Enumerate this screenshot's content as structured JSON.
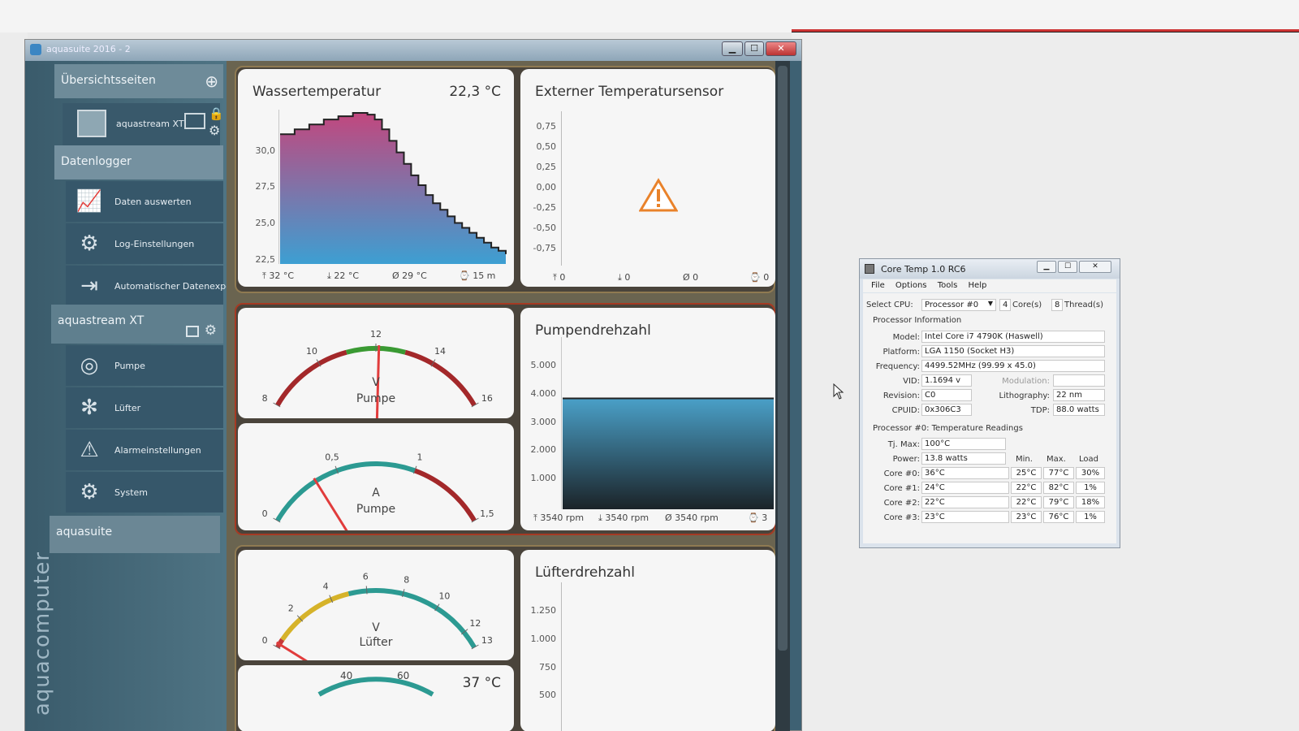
{
  "aquasuite": {
    "title": "aquasuite 2016 - 2",
    "sidebar": {
      "sections": [
        {
          "label": "Übersichtsseiten"
        },
        {
          "label": "Datenlogger"
        },
        {
          "label": "aquastream XT"
        },
        {
          "label": "aquasuite"
        }
      ],
      "overview_item": "aquastream XT",
      "datalogger_items": [
        {
          "label": "Daten auswerten",
          "icon": "chart-icon"
        },
        {
          "label": "Log-Einstellungen",
          "icon": "gear-icon"
        },
        {
          "label": "Automatischer Datenexport",
          "icon": "export-icon"
        }
      ],
      "device_items": [
        {
          "label": "Pumpe",
          "icon": "pump-icon"
        },
        {
          "label": "Lüfter",
          "icon": "fan-icon"
        },
        {
          "label": "Alarmeinstellungen",
          "icon": "warning-icon"
        },
        {
          "label": "System",
          "icon": "gear-icon"
        }
      ],
      "brand": "aquacomputer"
    },
    "panels": {
      "water_temp": {
        "title": "Wassertemperatur",
        "value": "22,3 °C",
        "y_ticks": [
          "30,0",
          "27,5",
          "25,0",
          "22,5"
        ],
        "stats": [
          "⤒ 32 °C",
          "⤓ 22 °C",
          "Ø 29 °C",
          "⌚ 15 m"
        ],
        "chart_data": {
          "type": "area",
          "ylim": [
            21.8,
            31.2
          ],
          "values": [
            29.7,
            29.7,
            30.0,
            30.0,
            30.3,
            30.3,
            30.6,
            30.6,
            30.8,
            30.8,
            31.0,
            31.0,
            30.9,
            30.6,
            30.0,
            29.3,
            28.6,
            27.9,
            27.2,
            26.6,
            26.0,
            25.5,
            25.1,
            24.7,
            24.3,
            24.0,
            23.7,
            23.4,
            23.1,
            22.8,
            22.6,
            22.4
          ]
        }
      },
      "external_sensor": {
        "title": "Externer Temperatursensor",
        "y_ticks": [
          "0,75",
          "0,50",
          "0,25",
          "0,00",
          "-0,25",
          "-0,50",
          "-0,75"
        ],
        "stats": [
          "⤒ 0",
          "⤓ 0",
          "Ø 0",
          "⌚ 0"
        ]
      },
      "pump_voltage": {
        "unit": "V",
        "label": "Pumpe",
        "ticks": [
          "8",
          "10",
          "12",
          "14",
          "16"
        ],
        "value": 12.1,
        "range": [
          8,
          16
        ]
      },
      "pump_current": {
        "unit": "A",
        "label": "Pumpe",
        "ticks": [
          "0",
          "0,5",
          "1",
          "1,5"
        ],
        "value": 0.35,
        "range": [
          0,
          1.5
        ]
      },
      "pump_speed": {
        "title": "Pumpendrehzahl",
        "y_ticks": [
          "5.000",
          "4.000",
          "3.000",
          "2.000",
          "1.000"
        ],
        "stats": [
          "⤒ 3540 rpm",
          "⤓ 3540 rpm",
          "Ø 3540 rpm",
          "⌚ 3"
        ],
        "chart_data": {
          "type": "area",
          "ylim": [
            0,
            5500
          ],
          "values": [
            3540,
            3540
          ]
        }
      },
      "fan_voltage": {
        "unit": "V",
        "label": "Lüfter",
        "ticks": [
          "0",
          "2",
          "4",
          "6",
          "8",
          "10",
          "12",
          "13"
        ],
        "value": 0.2,
        "range": [
          0,
          13
        ]
      },
      "fan_speed": {
        "title": "Lüfterdrehzahl",
        "y_ticks": [
          "1.250",
          "1.000",
          "750",
          "500"
        ]
      },
      "bottom_gauge": {
        "ticks": [
          "40",
          "60"
        ],
        "value": "37 °C"
      }
    }
  },
  "coretemp": {
    "title": "Core Temp 1.0 RC6",
    "menu": [
      "File",
      "Options",
      "Tools",
      "Help"
    ],
    "select_cpu_label": "Select CPU:",
    "select_cpu_value": "Processor #0",
    "cores_value": "4",
    "cores_label": "Core(s)",
    "threads_value": "8",
    "threads_label": "Thread(s)",
    "proc_info_header": "Processor Information",
    "model_label": "Model:",
    "model": "Intel Core i7 4790K (Haswell)",
    "platform_label": "Platform:",
    "platform": "LGA 1150 (Socket H3)",
    "frequency_label": "Frequency:",
    "frequency": "4499.52MHz (99.99 x 45.0)",
    "vid_label": "VID:",
    "vid": "1.1694 v",
    "modulation_label": "Modulation:",
    "revision_label": "Revision:",
    "revision": "C0",
    "lithography_label": "Lithography:",
    "lithography": "22 nm",
    "cpuid_label": "CPUID:",
    "cpuid": "0x306C3",
    "tdp_label": "TDP:",
    "tdp": "88.0 watts",
    "temp_header": "Processor #0: Temperature Readings",
    "tjmax_label": "Tj. Max:",
    "tjmax": "100°C",
    "power_label": "Power:",
    "power": "13.8 watts",
    "col_min": "Min.",
    "col_max": "Max.",
    "col_load": "Load",
    "cores": [
      {
        "label": "Core #0:",
        "temp": "36°C",
        "min": "25°C",
        "max": "77°C",
        "load": "30%"
      },
      {
        "label": "Core #1:",
        "temp": "24°C",
        "min": "22°C",
        "max": "82°C",
        "load": "1%"
      },
      {
        "label": "Core #2:",
        "temp": "22°C",
        "min": "22°C",
        "max": "79°C",
        "load": "18%"
      },
      {
        "label": "Core #3:",
        "temp": "23°C",
        "min": "23°C",
        "max": "76°C",
        "load": "1%"
      }
    ]
  }
}
